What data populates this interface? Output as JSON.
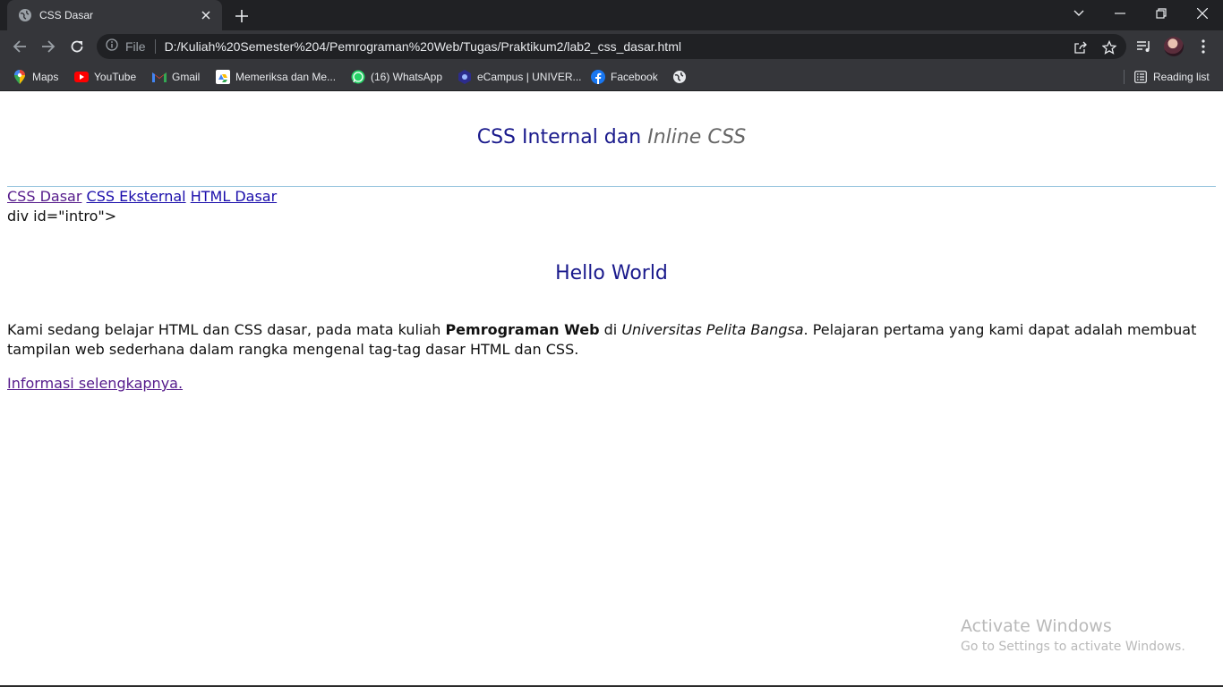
{
  "tab": {
    "title": "CSS Dasar"
  },
  "omnibox": {
    "site_info_label": "File",
    "url": "D:/Kuliah%20Semester%204/Pemrograman%20Web/Tugas/Praktikum2/lab2_css_dasar.html"
  },
  "bookmarks": [
    {
      "label": "Maps",
      "icon": "maps-icon"
    },
    {
      "label": "YouTube",
      "icon": "youtube-icon"
    },
    {
      "label": "Gmail",
      "icon": "gmail-icon"
    },
    {
      "label": "Memeriksa dan Me...",
      "icon": "google-drive-icon"
    },
    {
      "label": "(16) WhatsApp",
      "icon": "whatsapp-icon"
    },
    {
      "label": "eCampus | UNIVER...",
      "icon": "ecampus-icon"
    },
    {
      "label": "Facebook",
      "icon": "facebook-icon"
    }
  ],
  "reading_list_label": "Reading list",
  "page": {
    "title_main": "CSS Internal dan",
    "title_italic": "Inline CSS",
    "nav": [
      "CSS Dasar",
      "CSS Eksternal",
      "HTML Dasar"
    ],
    "stray_text": "div id=\"intro\">",
    "hello": "Hello World",
    "para_1": "Kami sedang belajar HTML dan CSS dasar, pada mata kuliah ",
    "para_bold": "Pemrograman Web",
    "para_2": " di ",
    "para_italic": "Universitas Pelita Bangsa",
    "para_3": ". Pelajaran pertama yang kami dapat adalah membuat tampilan web sederhana dalam rangka mengenal tag-tag dasar HTML dan CSS.",
    "more_link": "Informasi selengkapnya."
  },
  "watermark": {
    "line1": "Activate Windows",
    "line2": "Go to Settings to activate Windows."
  },
  "colors": {
    "chrome_dark": "#202124",
    "chrome_toolbar": "#35363a",
    "heading_blue": "#1a1a8c",
    "link_blue": "#1a0dab",
    "link_visited": "#551a8b"
  }
}
